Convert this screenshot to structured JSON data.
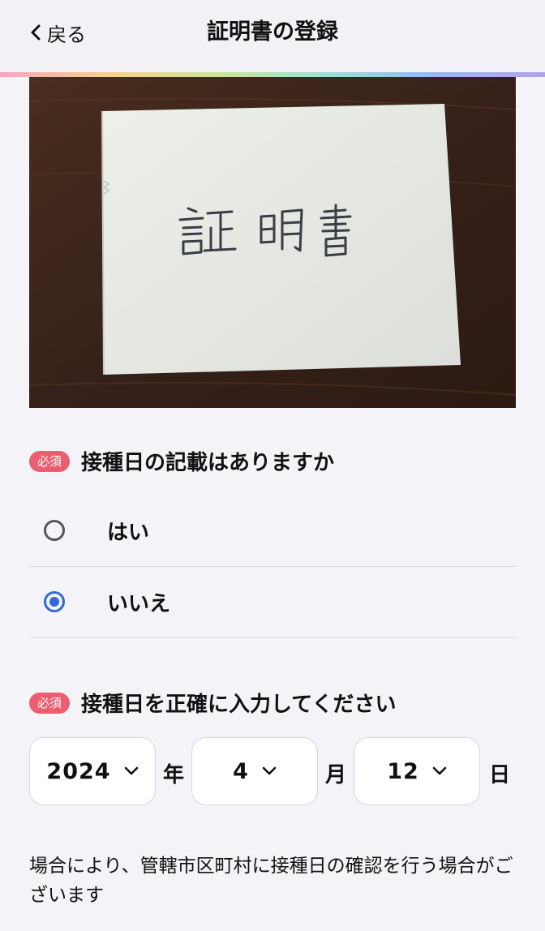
{
  "nav": {
    "back_label": "戻る",
    "title": "証明書の登録"
  },
  "photo": {
    "handwritten_text": "証明書"
  },
  "question1": {
    "badge": "必須",
    "text": "接種日の記載はありますか",
    "options": [
      {
        "label": "はい",
        "selected": false
      },
      {
        "label": "いいえ",
        "selected": true
      }
    ]
  },
  "question2": {
    "badge": "必須",
    "text": "接種日を正確に入力してください",
    "year": "2024",
    "year_unit": "年",
    "month": "4",
    "month_unit": "月",
    "day": "12",
    "day_unit": "日"
  },
  "note": "場合により、管轄市区町村に接種日の確認を行う場合がございます",
  "colors": {
    "badge": "#ec5d6f",
    "radio_selected": "#2f6ad8"
  }
}
